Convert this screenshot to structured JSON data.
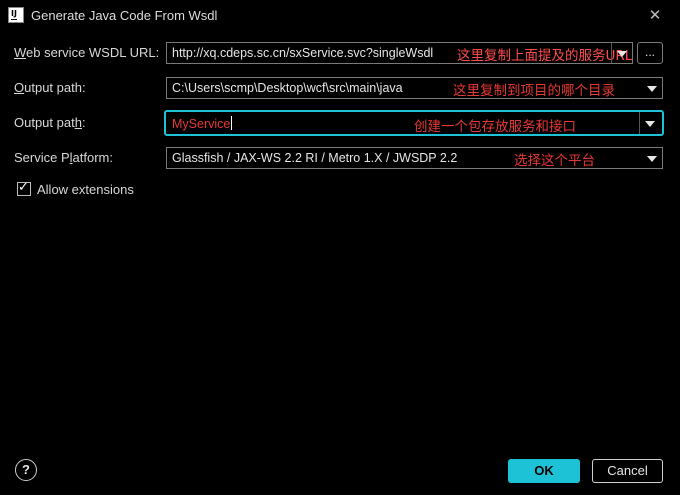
{
  "window": {
    "title": "Generate Java Code From Wsdl",
    "close_symbol": "✕"
  },
  "fields": [
    {
      "label_accel": "W",
      "label_rest": "eb service WSDL URL:",
      "value": "http://xq.cdeps.sc.cn/sxService.svc?singleWsdl",
      "note": "这里复制上面提及的服务URL",
      "browse_label": "..."
    },
    {
      "label_accel": "O",
      "label_rest": "utput path:",
      "value": "C:\\Users\\scmp\\Desktop\\wcf\\src\\main\\java",
      "note": "这里复制到项目的哪个目录"
    },
    {
      "label_pre": "Output pat",
      "label_accel": "h",
      "label_post": ":",
      "value": "MyService",
      "note": "创建一个包存放服务和接口"
    },
    {
      "label_pre": "Service P",
      "label_accel": "l",
      "label_post": "atform:",
      "value": "Glassfish / JAX-WS 2.2 RI / Metro 1.X / JWSDP 2.2",
      "note": "选择这个平台"
    }
  ],
  "allow_extensions": {
    "label": "Allow extensions",
    "checked": true
  },
  "footer": {
    "help": "?",
    "ok": "OK",
    "cancel": "Cancel"
  },
  "colors": {
    "accent": "#1dc2d6",
    "note": "#e53935",
    "background": "#000000"
  }
}
